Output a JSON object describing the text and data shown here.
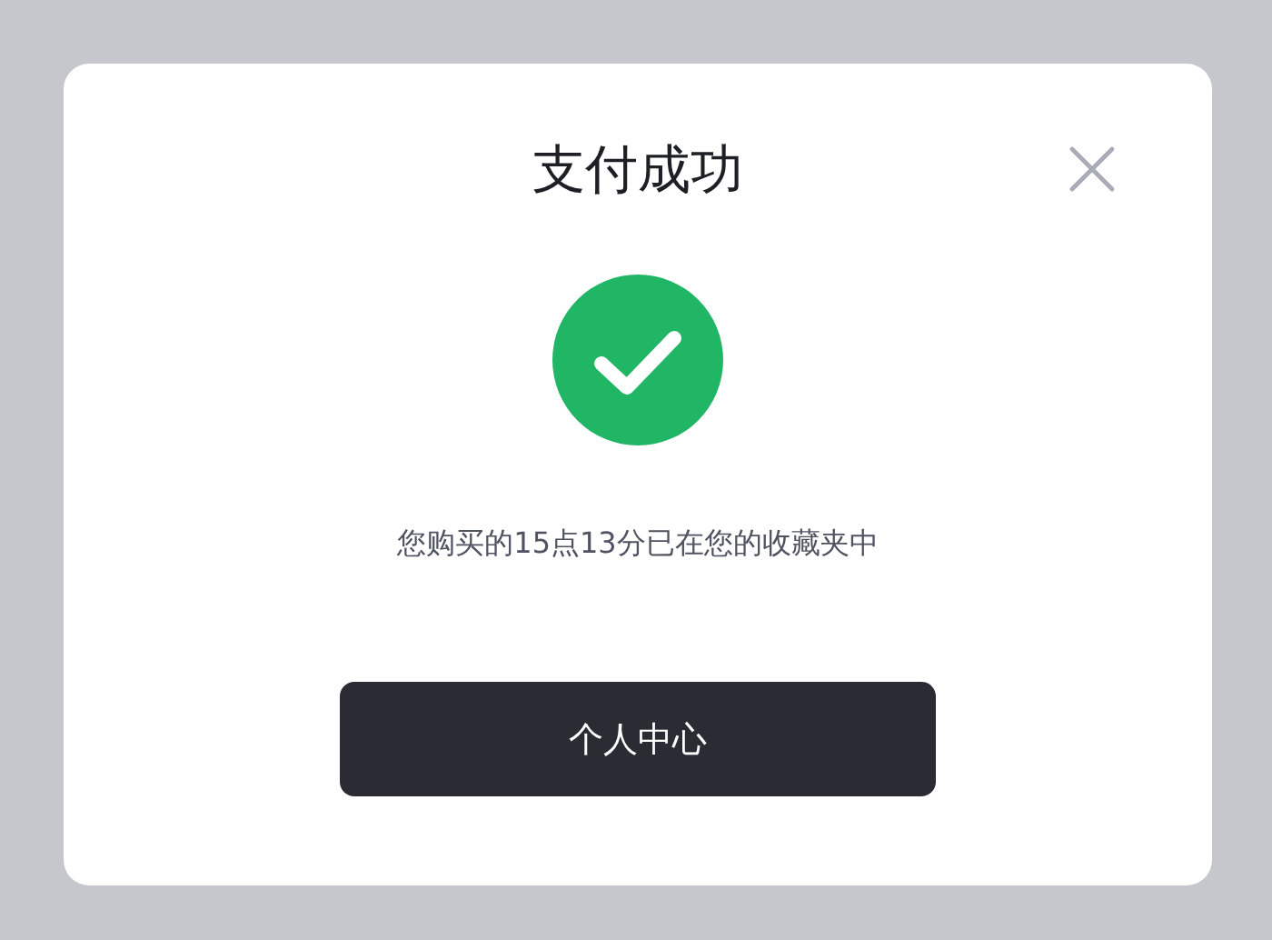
{
  "dialog": {
    "title": "支付成功",
    "message": "您购买的15点13分已在您的收藏夹中",
    "button": "个人中心"
  }
}
